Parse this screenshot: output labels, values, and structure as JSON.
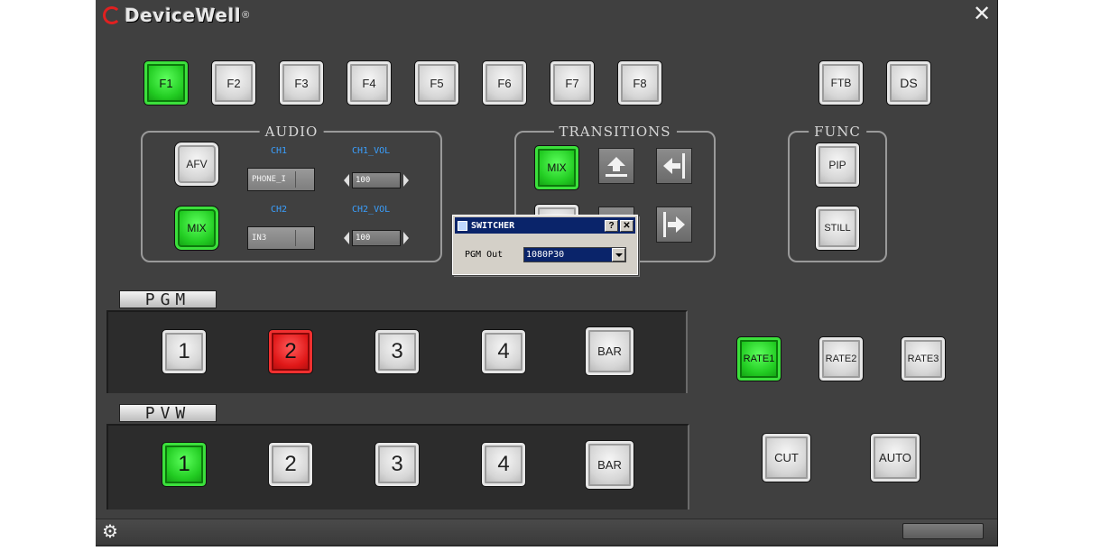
{
  "app": {
    "brand": "DeviceWell",
    "brand_reg": "®",
    "close_glyph": "✕",
    "settings_glyph": "⚙"
  },
  "fkeys": [
    "F1",
    "F2",
    "F3",
    "F4",
    "F5",
    "F6",
    "F7",
    "F8"
  ],
  "top_right": {
    "ftb": "FTB",
    "ds": "DS"
  },
  "audio": {
    "title": "AUDIO",
    "afv": "AFV",
    "mix": "MIX",
    "ch1_label": "CH1",
    "ch1_vol_label": "CH1_VOL",
    "ch2_label": "CH2",
    "ch2_vol_label": "CH2_VOL",
    "ch1_source": "PHONE_I",
    "ch2_source": "IN3",
    "ch1_vol": "100",
    "ch2_vol": "100"
  },
  "transitions": {
    "title": "TRANSITIONS",
    "mix": "MIX"
  },
  "func": {
    "title": "FUNC",
    "pip": "PIP",
    "still": "STILL"
  },
  "pgm": {
    "label": "PGM",
    "buttons": [
      "1",
      "2",
      "3",
      "4",
      "BAR"
    ],
    "active": "2"
  },
  "pvw": {
    "label": "PVW",
    "buttons": [
      "1",
      "2",
      "3",
      "4",
      "BAR"
    ],
    "active": "1"
  },
  "rates": [
    "RATE1",
    "RATE2",
    "RATE3"
  ],
  "cut": "CUT",
  "auto": "AUTO",
  "dialog": {
    "title": "SWITCHER",
    "help": "?",
    "close": "✕",
    "field_label": "PGM Out",
    "field_value": "1080P30"
  },
  "colors": {
    "active_green": "#22cc22",
    "active_red": "#e01818",
    "label_blue": "#3aa0ff",
    "background": "#404040"
  }
}
